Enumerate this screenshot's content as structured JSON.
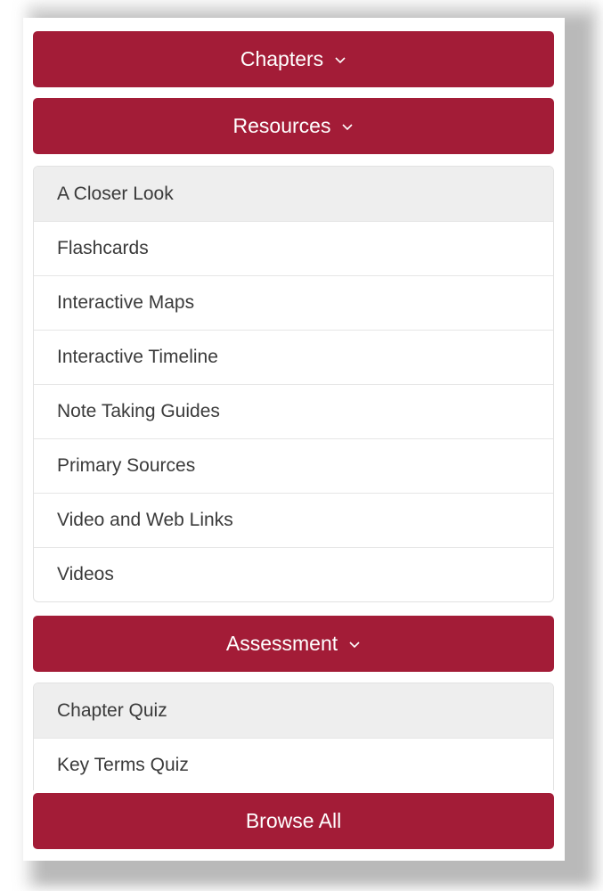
{
  "buttons": {
    "chapters": "Chapters",
    "resources": "Resources",
    "assessment": "Assessment",
    "browse_all": "Browse All"
  },
  "resources": {
    "items": [
      {
        "label": "A Closer Look",
        "active": true
      },
      {
        "label": "Flashcards"
      },
      {
        "label": "Interactive Maps"
      },
      {
        "label": "Interactive Timeline"
      },
      {
        "label": "Note Taking Guides"
      },
      {
        "label": "Primary Sources"
      },
      {
        "label": "Video and Web Links"
      },
      {
        "label": "Videos"
      }
    ]
  },
  "assessment": {
    "items": [
      {
        "label": "Chapter Quiz",
        "active": true
      },
      {
        "label": "Key Terms Quiz"
      }
    ]
  },
  "colors": {
    "accent": "#a31c37",
    "active_bg": "#eeeeee",
    "text": "#3a3a3a"
  },
  "icons": {
    "dropdown": "chevron-down-icon"
  }
}
